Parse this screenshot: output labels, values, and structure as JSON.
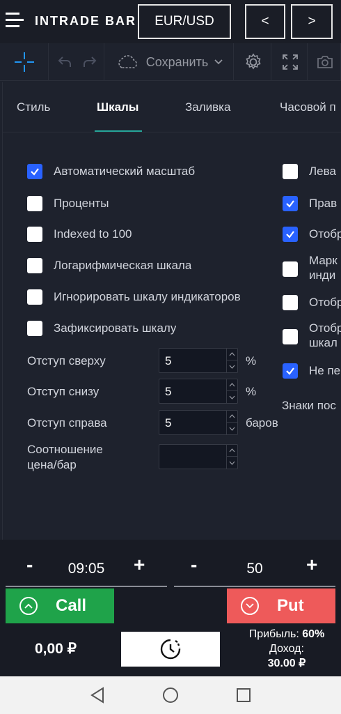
{
  "header": {
    "logo": "INTRADE BAR",
    "pair": "EUR/USD",
    "prev": "<",
    "next": ">"
  },
  "toolbar": {
    "save_label": "Сохранить"
  },
  "tabs": [
    {
      "label": "Стиль"
    },
    {
      "label": "Шкалы"
    },
    {
      "label": "Заливка"
    },
    {
      "label": "Часовой п"
    }
  ],
  "left_options": [
    {
      "label": "Автоматический масштаб",
      "checked": true
    },
    {
      "label": "Проценты",
      "checked": false
    },
    {
      "label": "Indexed to 100",
      "checked": false
    },
    {
      "label": "Логарифмическая шкала",
      "checked": false
    },
    {
      "label": "Игнорировать шкалу индикаторов",
      "checked": false
    },
    {
      "label": "Зафиксировать шкалу",
      "checked": false
    }
  ],
  "right_options": [
    {
      "label": "Лева",
      "label2": "",
      "checked": false
    },
    {
      "label": "Прав",
      "label2": "",
      "checked": true
    },
    {
      "label": "Отобр",
      "label2": "",
      "checked": true
    },
    {
      "label": "Марк",
      "label2": "инди",
      "checked": false
    },
    {
      "label": "Отобр",
      "label2": "",
      "checked": false
    },
    {
      "label": "Отобр",
      "label2": "шкал",
      "checked": false
    },
    {
      "label": "Не пе",
      "label2": "",
      "checked": true
    }
  ],
  "right_section_title": "Знаки пос",
  "fields": [
    {
      "label": "Отступ сверху",
      "value": "5",
      "unit": "%"
    },
    {
      "label": "Отступ снизу",
      "value": "5",
      "unit": "%"
    },
    {
      "label": "Отступ справа",
      "value": "5",
      "unit": "баров"
    },
    {
      "label": "Соотношение",
      "label2": "цена/бар",
      "value": "",
      "unit": ""
    }
  ],
  "trade": {
    "time": "09:05",
    "amount": "50",
    "minus": "-",
    "plus": "+",
    "call_label": "Call",
    "put_label": "Put",
    "balance": "0,00 ₽",
    "profit_label": "Прибыль:",
    "profit_value": "60%",
    "income_label": "Доход:",
    "income_value": "30.00 ₽"
  },
  "colors": {
    "background": "#1e222d",
    "accent_tab": "#26a69a",
    "checkbox_checked": "#2962ff",
    "call": "#1fa34a",
    "put": "#ee5a5a"
  }
}
